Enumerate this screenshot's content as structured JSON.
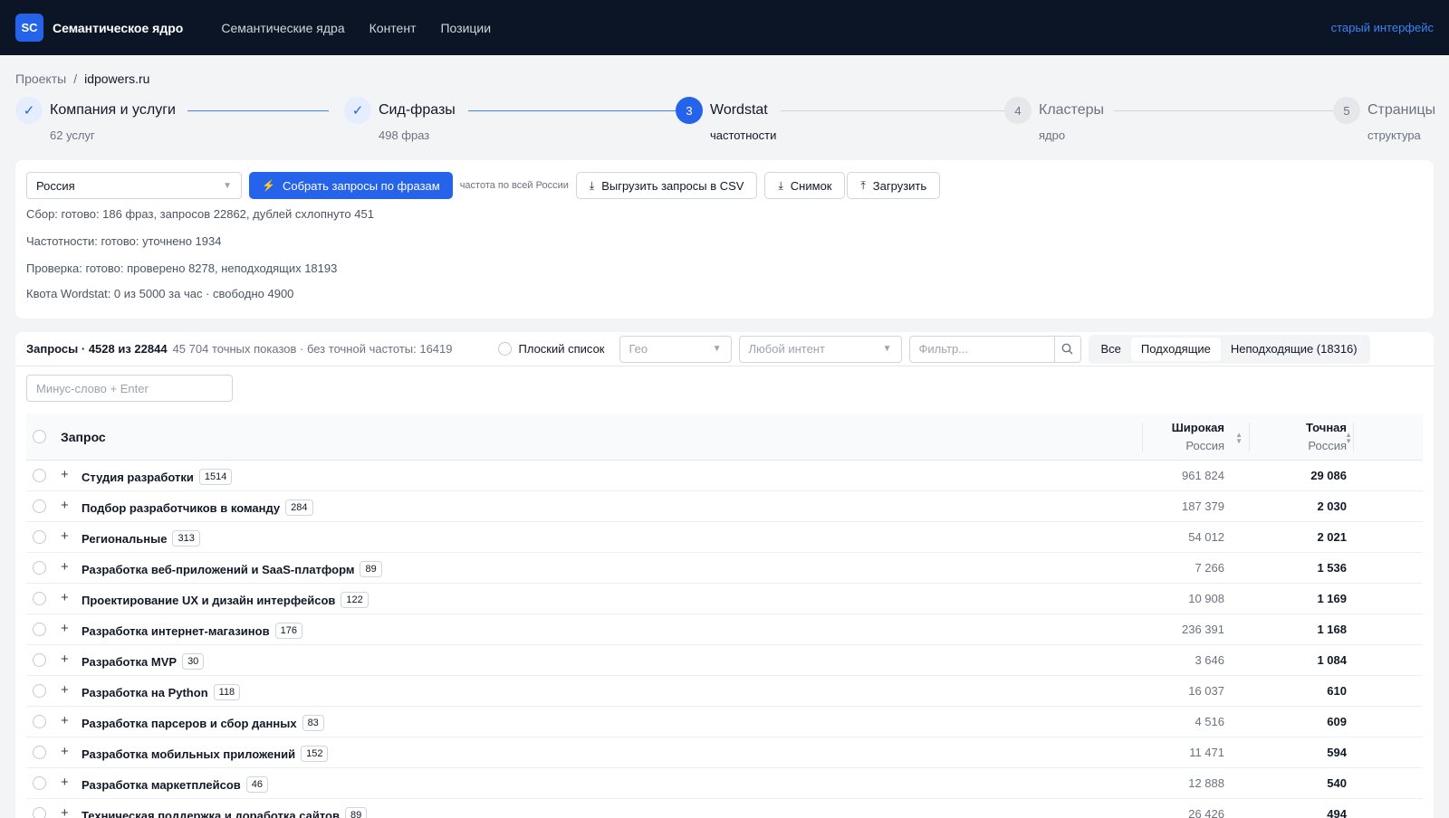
{
  "header": {
    "logo": "SC",
    "title": "Семантическое ядро",
    "nav": [
      "Семантические ядра",
      "Контент",
      "Позиции"
    ],
    "old_ui_link": "старый интерфейс"
  },
  "breadcrumb": {
    "root": "Проекты",
    "sep": "/",
    "current": "idpowers.ru"
  },
  "steps": [
    {
      "num": "✓",
      "label": "Компания и услуги",
      "sub": "62 услуг",
      "state": "done"
    },
    {
      "num": "✓",
      "label": "Сид-фразы",
      "sub": "498 фраз",
      "state": "done"
    },
    {
      "num": "3",
      "label": "Wordstat",
      "sub": "частотности",
      "state": "active"
    },
    {
      "num": "4",
      "label": "Кластеры",
      "sub": "ядро",
      "state": "todo"
    },
    {
      "num": "5",
      "label": "Страницы",
      "sub": "структура",
      "state": "todo"
    }
  ],
  "collect": {
    "region": "Россия",
    "collect_button": "Собрать запросы по фразам",
    "hint": "частота по всей России",
    "export_button": "Выгрузить запросы в CSV",
    "snapshot_button": "Снимок",
    "upload_button": "Загрузить",
    "status": [
      "Сбор: готово: 186 фраз, запросов 22862, дублей схлопнуто 451",
      "Частотности: готово: уточнено 1934",
      "Проверка: готово: проверено 8278, неподходящих 18193",
      "Квота Wordstat: 0 из 5000 за час · свободно 4900"
    ]
  },
  "queries": {
    "title": "Запросы · 4528 из 22844",
    "subtitle": "45 704 точных показов · без точной частоты: 16419",
    "flat_list": "Плоский список",
    "geo_placeholder": "Гео",
    "intent_placeholder": "Любой интент",
    "filter_placeholder": "Фильтр...",
    "segments": [
      "Все",
      "Подходящие",
      "Неподходящие (18316)"
    ],
    "minus_placeholder": "Минус-слово + Enter",
    "columns": {
      "query": "Запрос",
      "broad": "Широкая",
      "broad_sub": "Россия",
      "exact": "Точная",
      "exact_sub": "Россия"
    },
    "rows": [
      {
        "name": "Студия разработки",
        "count": "1514",
        "broad": "961 824",
        "exact": "29 086"
      },
      {
        "name": "Подбор разработчиков в команду",
        "count": "284",
        "broad": "187 379",
        "exact": "2 030"
      },
      {
        "name": "Региональные",
        "count": "313",
        "broad": "54 012",
        "exact": "2 021"
      },
      {
        "name": "Разработка веб-приложений и SaaS-платформ",
        "count": "89",
        "broad": "7 266",
        "exact": "1 536"
      },
      {
        "name": "Проектирование UX и дизайн интерфейсов",
        "count": "122",
        "broad": "10 908",
        "exact": "1 169"
      },
      {
        "name": "Разработка интернет-магазинов",
        "count": "176",
        "broad": "236 391",
        "exact": "1 168"
      },
      {
        "name": "Разработка MVP",
        "count": "30",
        "broad": "3 646",
        "exact": "1 084"
      },
      {
        "name": "Разработка на Python",
        "count": "118",
        "broad": "16 037",
        "exact": "610"
      },
      {
        "name": "Разработка парсеров и сбор данных",
        "count": "83",
        "broad": "4 516",
        "exact": "609"
      },
      {
        "name": "Разработка мобильных приложений",
        "count": "152",
        "broad": "11 471",
        "exact": "594"
      },
      {
        "name": "Разработка маркетплейсов",
        "count": "46",
        "broad": "12 888",
        "exact": "540"
      },
      {
        "name": "Техническая поддержка и доработка сайтов",
        "count": "89",
        "broad": "26 426",
        "exact": "494"
      }
    ]
  }
}
